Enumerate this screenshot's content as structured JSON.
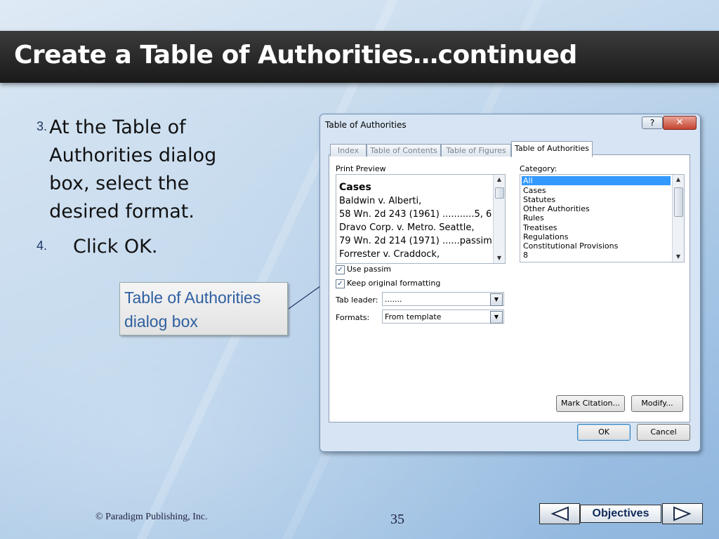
{
  "slide": {
    "title": "Create a Table of Authorities…continued",
    "steps": [
      {
        "num": "3.",
        "text": "At the Table of Authorities dialog box, select the desired format."
      },
      {
        "num": "4.",
        "text": "Click OK."
      }
    ],
    "callout": "Table of Authorities dialog box",
    "copyright": "© Paradigm Publishing, Inc.",
    "page_number": "35",
    "nav": {
      "label": "Objectives",
      "prev_icon": "left-triangle-icon",
      "next_icon": "right-triangle-icon"
    }
  },
  "dialog": {
    "title": "Table of Authorities",
    "help": "?",
    "close": "✕",
    "tabs": [
      "Index",
      "Table of Contents",
      "Table of Figures",
      "Table of Authorities"
    ],
    "active_tab": "Table of Authorities",
    "print_preview_label": "Print Preview",
    "preview_lines": [
      "Cases",
      "Baldwin v. Alberti,",
      "   58 Wn. 2d 243 (1961) ...........5, 6",
      "Dravo Corp. v. Metro. Seattle,",
      "   79 Wn. 2d 214 (1971) ......passim",
      "Forrester v. Craddock,"
    ],
    "category_label": "Category:",
    "categories": [
      "All",
      "Cases",
      "Statutes",
      "Other Authorities",
      "Rules",
      "Treatises",
      "Regulations",
      "Constitutional Provisions",
      "8"
    ],
    "selected_category": "All",
    "use_passim": {
      "label": "Use passim",
      "checked": true
    },
    "keep_formatting": {
      "label": "Keep original formatting",
      "checked": true
    },
    "tab_leader": {
      "label": "Tab leader:",
      "value": "......."
    },
    "formats": {
      "label": "Formats:",
      "value": "From template"
    },
    "buttons": {
      "mark_citation": "Mark Citation...",
      "modify": "Modify...",
      "ok": "OK",
      "cancel": "Cancel"
    }
  },
  "colors": {
    "title_bar": "#1f1f1f",
    "callout_text": "#2e5fa0",
    "selection": "#3399ff"
  }
}
